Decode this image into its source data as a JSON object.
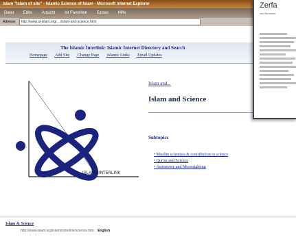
{
  "window": {
    "title": "Islam \"Islam of site\" - Islamic Science of Islam - Microsoft Internet Explorer"
  },
  "menu": [
    "Datei",
    "Edits",
    "Ansicht",
    "Ist Favoriten",
    "Extras",
    "Hilfe"
  ],
  "address": {
    "label": "Adresse",
    "url": "http://www.al-islam.org/..../islam-and-science.html"
  },
  "banner": {
    "title": "The Islamic Interlink: Islamic Internet Directory and Search",
    "links": [
      "Homepage",
      "Add Site",
      "Change Page",
      "Islamic Links",
      "Email Updates"
    ]
  },
  "content": {
    "breadcrumb": "Islam and...",
    "heading": "Islam and Science",
    "subtopics_label": "Subtopics",
    "topics": [
      "Muslim scientists & contribution to science",
      "Qur'an and Science",
      "Astronomy and Moonsighting"
    ],
    "logo_caption": "ISLAMICINTERLINK"
  },
  "footer": {
    "link": "Islam & Science",
    "url": "http://www.islam.org/islamicinterlink/science.htm",
    "lang": "English"
  },
  "overlay": {
    "title": "Zerfa",
    "sub": "von Benutzer"
  },
  "colors": {
    "accent": "#1a2aa0",
    "logo_blue": "#1a237e"
  }
}
